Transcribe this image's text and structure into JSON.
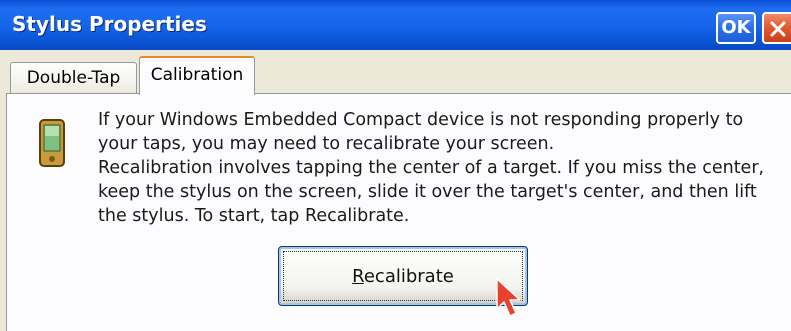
{
  "window": {
    "title": "Stylus Properties",
    "ok_label": "OK",
    "close_icon": "close-icon"
  },
  "tabs": [
    {
      "label": "Double-Tap",
      "selected": false
    },
    {
      "label": "Calibration",
      "selected": true
    }
  ],
  "calibration": {
    "icon": "pda-device-icon",
    "paragraph1": "If your Windows Embedded Compact device is not responding properly to your taps, you may need to recalibrate your screen.",
    "paragraph2": "Recalibration involves tapping the center of a target. If you miss the center, keep the stylus on the screen, slide it over the target's center, and then lift the stylus. To start, tap Recalibrate.",
    "recalibrate_accel": "R",
    "recalibrate_rest": "ecalibrate"
  },
  "colors": {
    "titlebar": "#1766ea",
    "close": "#e2572f",
    "tab_highlight": "#e68b2c",
    "cursor": "#e8412c"
  }
}
